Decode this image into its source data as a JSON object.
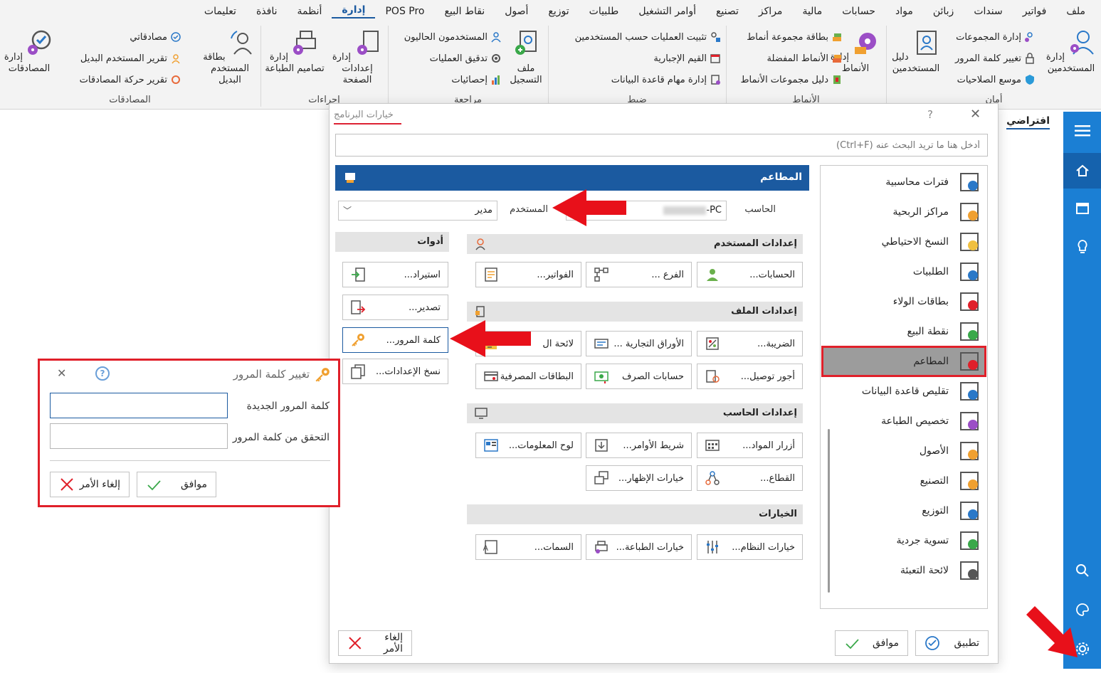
{
  "menubar": [
    "ملف",
    "فواتير",
    "سندات",
    "زبائن",
    "مواد",
    "حسابات",
    "مالية",
    "مراكز",
    "تصنيع",
    "أوامر التشغيل",
    "طلبيات",
    "توزيع",
    "أصول",
    "نقاط البيع",
    "POS Pro",
    "إدارة",
    "أنظمة",
    "نافذة",
    "تعليمات"
  ],
  "menubar_active": "إدارة",
  "ribbon": {
    "users_group": {
      "big1": "إدارة المستخدمين",
      "big2": "دليل المستخدمين",
      "i1": "إدارة المجموعات",
      "i2": "تغيير كلمة المرور",
      "i3": "موسع الصلاحيات",
      "label": "أمان"
    },
    "patterns_group": {
      "big1": "إدارة الأنماط",
      "i1": "بطاقة مجموعة أنماط",
      "i2": "الأنماط المفضلة",
      "i3": "دليل مجموعات الأنماط",
      "label": "الأنماط"
    },
    "control_group": {
      "i1": "تثبيت العمليات حسب المستخدمين",
      "i2": "القيم الإجبارية",
      "i3": "إدارة مهام قاعدة البيانات",
      "label": "ضبط"
    },
    "review_group": {
      "big1": "ملف التسجيل",
      "i1": "المستخدمون الحاليون",
      "i2": "تدقيق العمليات",
      "i3": "إحصائيات",
      "label": "مراجعة"
    },
    "procedures_group": {
      "big1": "إدارة إعدادات الصفحة",
      "big2": "إدارة تصاميم الطباعة",
      "label": "إجراءات"
    },
    "auth_group": {
      "big1": "بطاقة المستخدم البديل",
      "i1": "مصادقاتي",
      "i2": "تقرير المستخدم البديل",
      "i3": "تقرير حركة المصادقات",
      "big2": "إدارة المصادقات",
      "label": "المصادقات"
    }
  },
  "default_tab": "افتراضي",
  "dialog": {
    "title": "خيارات البرنامج",
    "help": "?",
    "close": "✕",
    "search_placeholder": "أدخل هنا ما تريد البحث عنه (Ctrl+F)",
    "nav": [
      "فترات محاسبية",
      "مراكز الربحية",
      "النسخ الاحتياطي",
      "الطلبيات",
      "بطاقات الولاء",
      "نقطة البيع",
      "المطاعم",
      "تقليص قاعدة البيانات",
      "تخصيص الطباعة",
      "الأصول",
      "التصنيع",
      "التوزيع",
      "تسوية جردية",
      "لائحة التعبئة"
    ],
    "nav_selected": "المطاعم",
    "pane_title": "المطاعم",
    "computer_label": "الحاسب",
    "computer_value": "PC-",
    "user_label": "المستخدم",
    "user_value": "مدير",
    "user_settings": "إعدادات المستخدم",
    "file_settings": "إعدادات الملف",
    "computer_settings": "إعدادات الحاسب",
    "options": "الخيارات",
    "tools": "أدوات",
    "btn_accounts": "الحسابات...",
    "btn_branch": "الفرع ...",
    "btn_invoices": "الفواتير...",
    "btn_tax": "الضريبة...",
    "btn_papers": "الأوراق التجارية ...",
    "btn_list": "لائحة ال",
    "btn_delivery": "أجور توصيل...",
    "btn_exchange": "حسابات الصرف",
    "btn_cards": "البطاقات المصرفية",
    "btn_material_btns": "أزرار المواد...",
    "btn_cmdbar": "شريط الأوامر...",
    "btn_infoboard": "لوح المعلومات...",
    "btn_sector": "القطاع...",
    "btn_display": "خيارات الإظهار...",
    "btn_sysopts": "خيارات النظام...",
    "btn_printopts": "خيارات الطباعة...",
    "btn_features": "السمات...",
    "btn_import": "استيراد...",
    "btn_export": "تصدير...",
    "btn_password": "كلمة المرور...",
    "btn_copysettings": "نسخ الإعدادات...",
    "apply": "تطبيق",
    "ok": "موافق",
    "cancel": "إلغاء الأمر"
  },
  "pwd_dialog": {
    "title": "تغيير كلمة المرور",
    "new_label": "كلمة المرور الجديدة",
    "verify_label": "التحقق من كلمة المرور",
    "ok": "موافق",
    "cancel": "إلغاء الأمر"
  },
  "colors": {
    "accent": "#1b5aa0",
    "sidebar": "#1b7fd4",
    "highlight": "#e0202a"
  }
}
